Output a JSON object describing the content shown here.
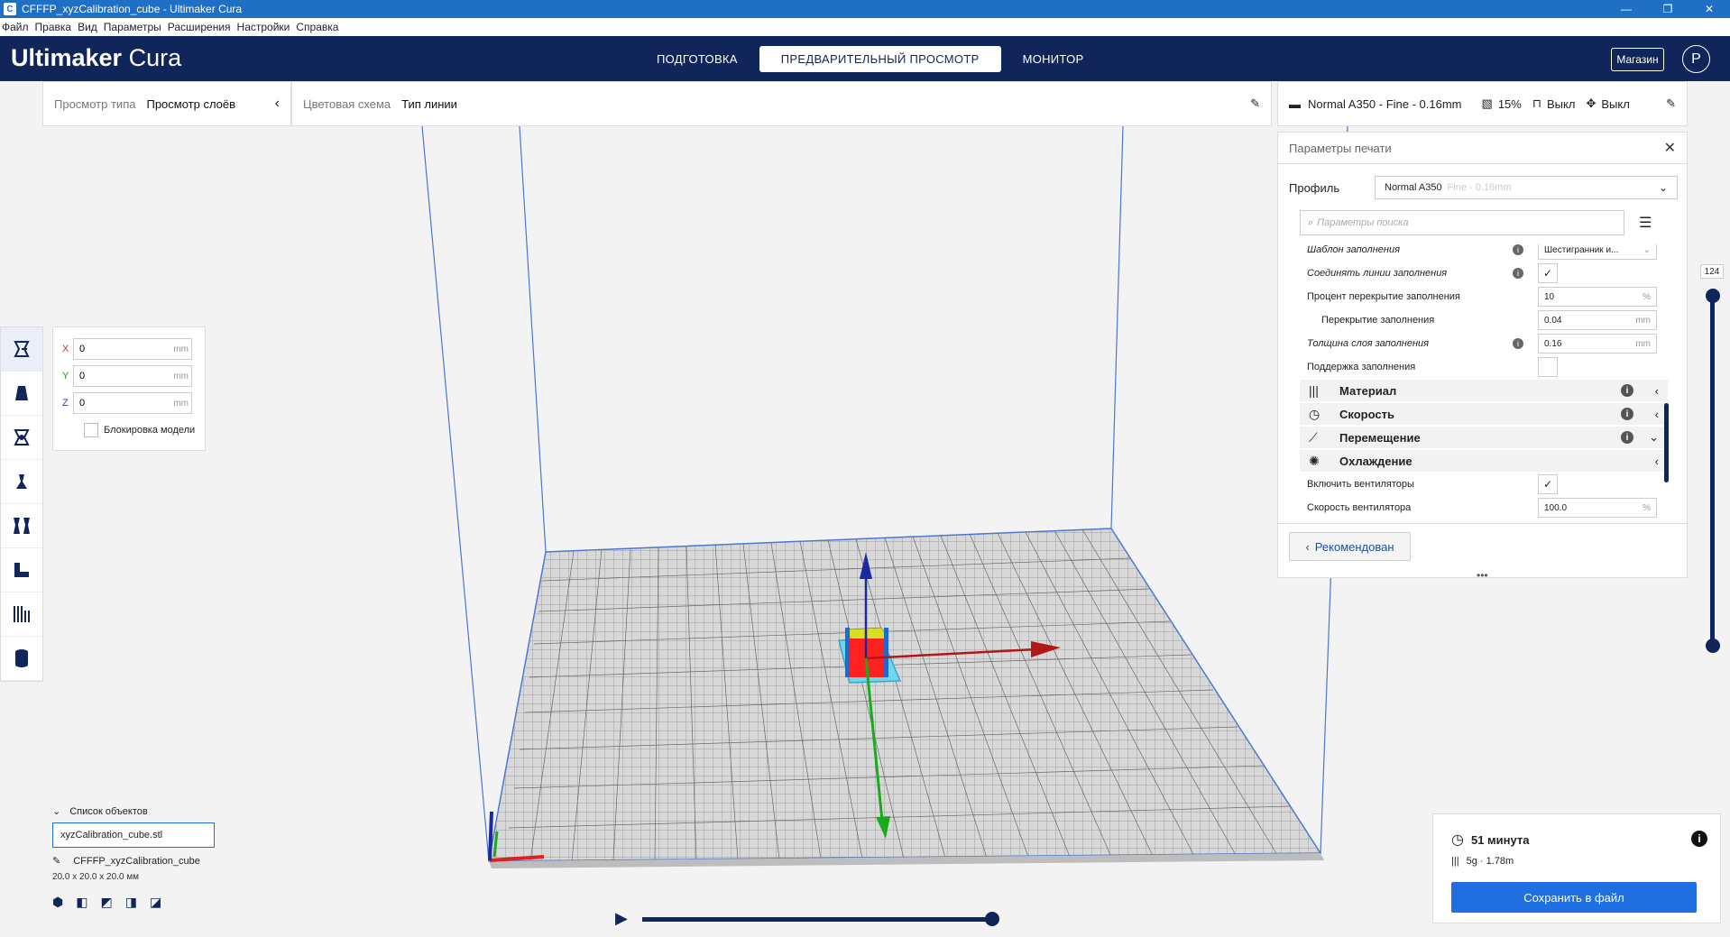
{
  "window": {
    "title": "CFFFP_xyzCalibration_cube - Ultimaker Cura",
    "minimize": "—",
    "maximize": "❐",
    "close": "✕"
  },
  "menu": [
    "Файл",
    "Правка",
    "Вид",
    "Параметры",
    "Расширения",
    "Настройки",
    "Справка"
  ],
  "header": {
    "logo_bold": "Ultimaker",
    "logo_rest": " Cura",
    "stages": [
      "ПОДГОТОВКА",
      "ПРЕДВАРИТЕЛЬНЫЙ ПРОСМОТР",
      "МОНИТОР"
    ],
    "store": "Магазин",
    "avatar": "P"
  },
  "view_bar": {
    "view_type_label": "Просмотр типа",
    "view_type_value": "Просмотр слоёв",
    "color_scheme_label": "Цветовая схема",
    "color_scheme_value": "Тип линии"
  },
  "print_setup_bar": {
    "profile": "Normal A350 - Fine - 0.16mm",
    "infill": "15%",
    "support": "Выкл",
    "adhesion": "Выкл"
  },
  "move_panel": {
    "x_label": "X",
    "x_value": "0",
    "y_label": "Y",
    "y_value": "0",
    "z_label": "Z",
    "z_value": "0",
    "unit": "mm",
    "lock_label": "Блокировка модели"
  },
  "settings_panel": {
    "title": "Параметры печати",
    "profile_label": "Профиль",
    "profile_value": "Normal A350",
    "profile_suffix": "Fine - 0.16mm",
    "search_placeholder": "Параметры поиска",
    "rows": {
      "infill_pattern": {
        "name": "Шаблон заполнения",
        "value": "Шестигранник и..."
      },
      "connect_infill": {
        "name": "Соединять линии заполнения"
      },
      "infill_overlap_pct": {
        "name": "Процент перекрытие заполнения",
        "value": "10",
        "unit": "%"
      },
      "infill_overlap": {
        "name": "Перекрытие заполнения",
        "value": "0.04",
        "unit": "mm"
      },
      "infill_layer_thickness": {
        "name": "Толщина слоя заполнения",
        "value": "0.16",
        "unit": "mm"
      },
      "infill_support": {
        "name": "Поддержка заполнения"
      },
      "enable_fans": {
        "name": "Включить вентиляторы"
      },
      "fan_speed": {
        "name": "Скорость вентилятора",
        "value": "100.0",
        "unit": "%"
      }
    },
    "categories": {
      "material": "Материал",
      "speed": "Скорость",
      "travel": "Перемещение",
      "cooling": "Охлаждение"
    },
    "recommended_button": "Рекомендован"
  },
  "layer_slider": {
    "current_layer": "124"
  },
  "object_list": {
    "header": "Список объектов",
    "selected_item": "xyzCalibration_cube.stl",
    "object_name": "CFFFP_xyzCalibration_cube",
    "dimensions": "20.0 x 20.0 x 20.0 мм"
  },
  "print_info": {
    "time": "51 минута",
    "material": "5g · 1.78m",
    "save_button": "Сохранить в файл"
  },
  "colors": {
    "header_bg": "#10265a",
    "accent": "#1f6fe0",
    "model": "#ff2020",
    "axis_x": "#c01818",
    "axis_y": "#1aaa1a",
    "axis_z": "#1a2aa0"
  }
}
